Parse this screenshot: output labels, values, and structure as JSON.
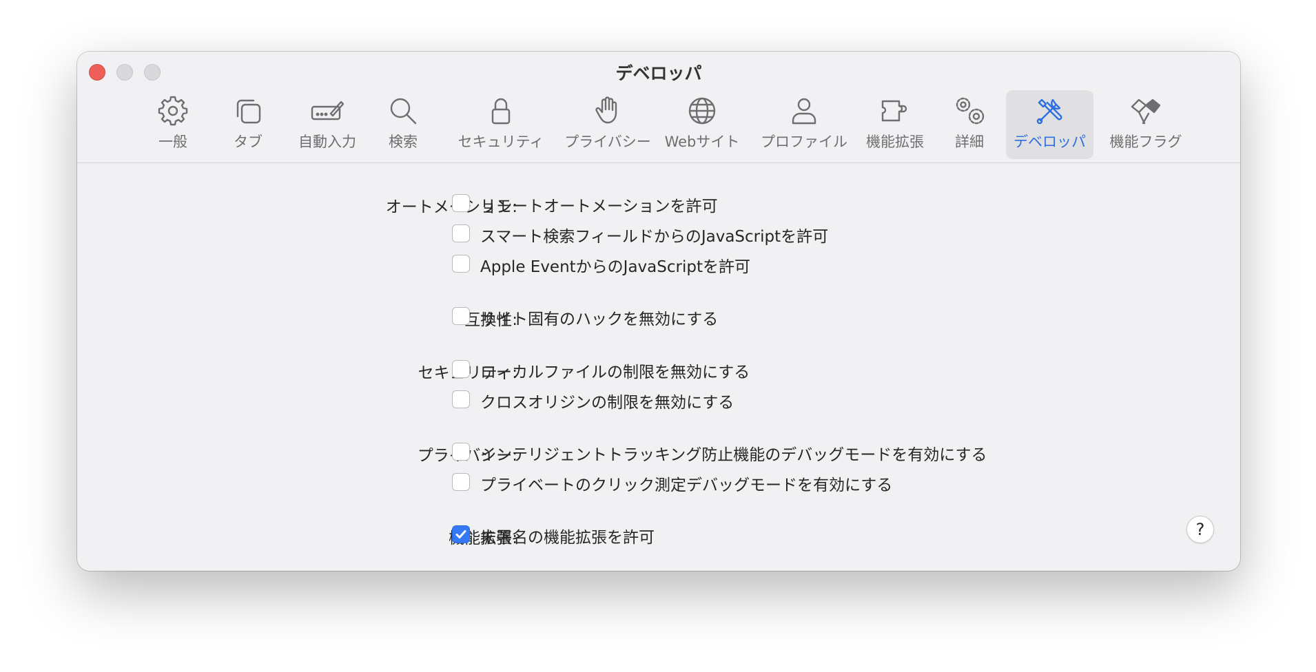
{
  "window": {
    "title": "デベロッパ"
  },
  "colors": {
    "accent": "#3478f6",
    "active_icon": "#2f6fe0",
    "close_button": "#ee5f5a"
  },
  "toolbar": {
    "items": [
      {
        "label": "一般",
        "icon": "gear-icon"
      },
      {
        "label": "タブ",
        "icon": "tabs-icon"
      },
      {
        "label": "自動入力",
        "icon": "autofill-pen-icon"
      },
      {
        "label": "検索",
        "icon": "magnifier-icon"
      },
      {
        "label": "セキュリティ",
        "icon": "lock-icon"
      },
      {
        "label": "プライバシー",
        "icon": "hand-icon"
      },
      {
        "label": "Webサイト",
        "icon": "globe-icon"
      },
      {
        "label": "プロファイル",
        "icon": "person-icon"
      },
      {
        "label": "機能拡張",
        "icon": "puzzle-icon"
      },
      {
        "label": "詳細",
        "icon": "gears-icon"
      },
      {
        "label": "デベロッパ",
        "icon": "tools-icon",
        "selected": true
      },
      {
        "label": "機能フラグ",
        "icon": "flags-icon"
      }
    ]
  },
  "settings": {
    "automation": {
      "label": "オートメーション:",
      "options": [
        {
          "text": "リモートオートメーションを許可",
          "checked": false
        },
        {
          "text": "スマート検索フィールドからのJavaScriptを許可",
          "checked": false
        },
        {
          "text": "Apple EventからのJavaScriptを許可",
          "checked": false
        }
      ]
    },
    "compatibility": {
      "label": "互換性:",
      "options": [
        {
          "text": "サイト固有のハックを無効にする",
          "checked": false
        }
      ]
    },
    "security": {
      "label": "セキュリティ:",
      "options": [
        {
          "text": "ローカルファイルの制限を無効にする",
          "checked": false
        },
        {
          "text": "クロスオリジンの制限を無効にする",
          "checked": false
        }
      ]
    },
    "privacy": {
      "label": "プライバシー:",
      "options": [
        {
          "text": "インテリジェントトラッキング防止機能のデバッグモードを有効にする",
          "checked": false
        },
        {
          "text": "プライベートのクリック測定デバッグモードを有効にする",
          "checked": false
        }
      ]
    },
    "extensions": {
      "label": "機能拡張:",
      "options": [
        {
          "text": "未署名の機能拡張を許可",
          "checked": true
        }
      ]
    }
  },
  "help": {
    "label": "?"
  }
}
